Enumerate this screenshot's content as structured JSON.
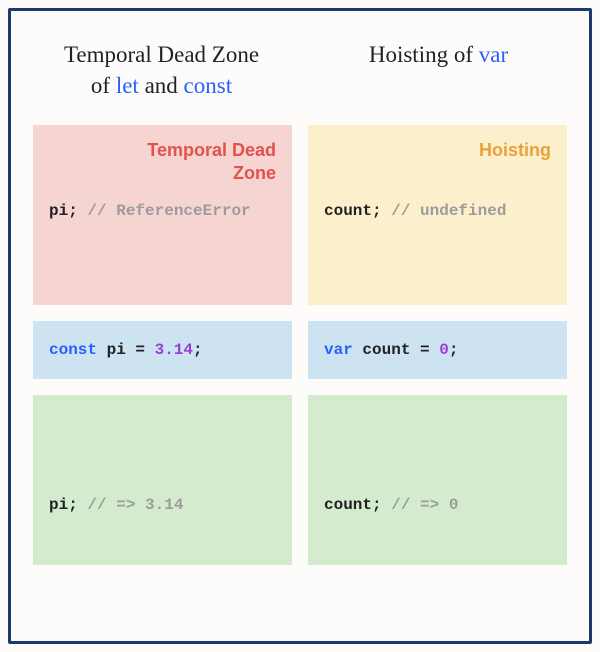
{
  "headers": {
    "left": {
      "line1": "Temporal Dead Zone",
      "of": "of ",
      "let": "let",
      "and": " and ",
      "const": "const"
    },
    "right": {
      "text": "Hoisting of ",
      "var": "var"
    }
  },
  "zones": {
    "tdz_label_l1": "Temporal Dead",
    "tdz_label_l2": "Zone",
    "hoist_label": "Hoisting"
  },
  "code": {
    "tdz_before_var": "pi;",
    "tdz_before_comment": " // ReferenceError",
    "hoist_before_var": "count;",
    "hoist_before_comment": " // undefined",
    "decl_left_kw": "const",
    "decl_left_name": " pi = ",
    "decl_left_val": "3.14",
    "decl_left_end": ";",
    "decl_right_kw": "var",
    "decl_right_name": " count = ",
    "decl_right_val": "0",
    "decl_right_end": ";",
    "after_left_var": "pi;",
    "after_left_comment": " // => 3.14",
    "after_right_var": "count;",
    "after_right_comment": " // => 0"
  }
}
